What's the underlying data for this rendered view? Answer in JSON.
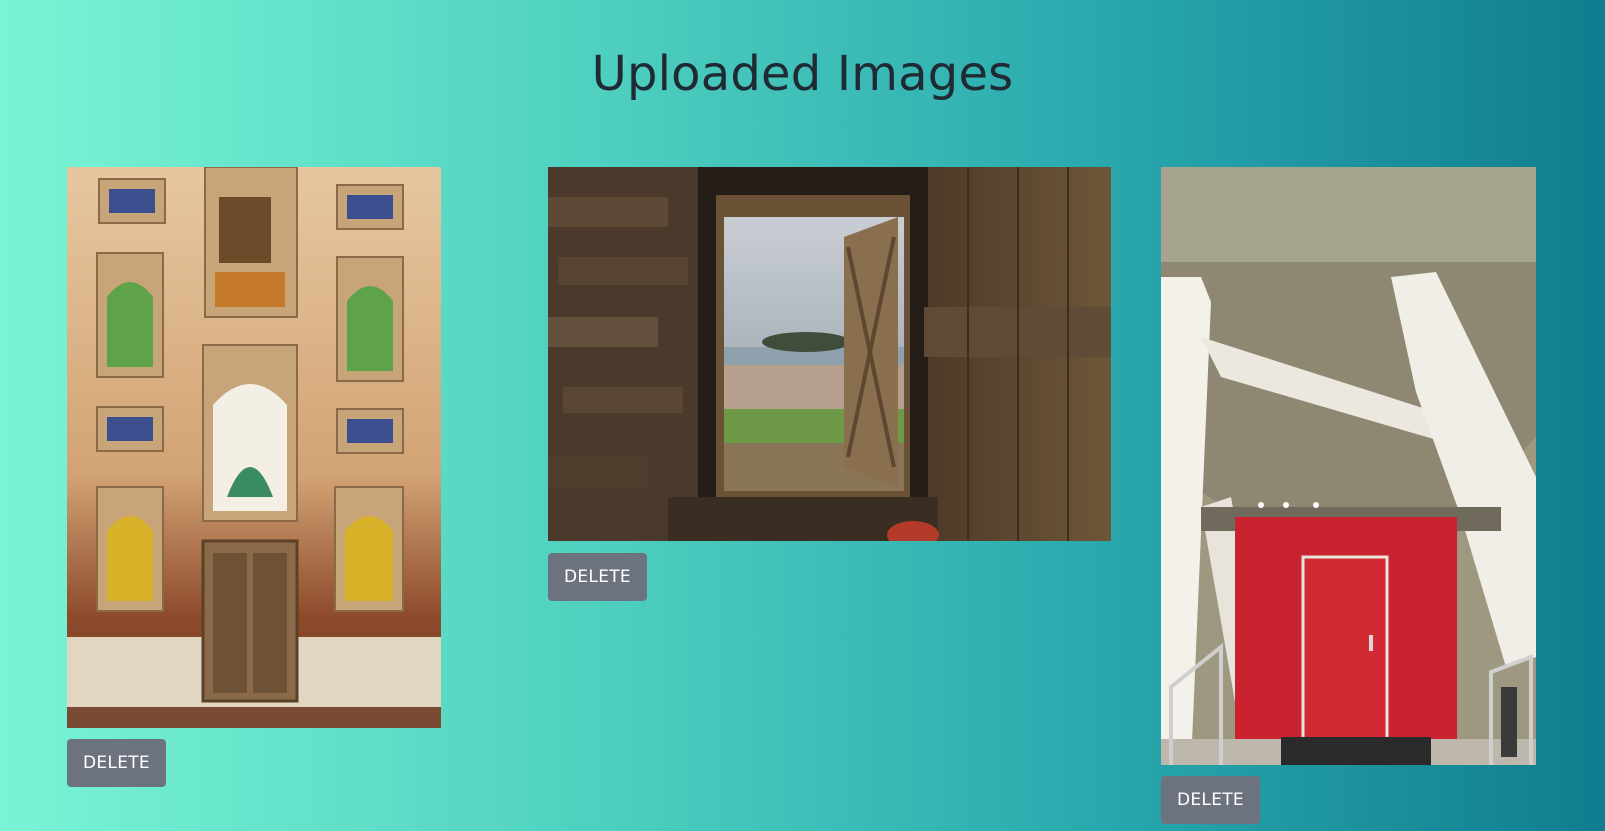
{
  "page": {
    "title": "Uploaded Images",
    "background_gradient": [
      "#79f5d5",
      "#0f7d8f"
    ]
  },
  "images": [
    {
      "subject": "tiled-facade-image",
      "delete_label": "DELETE"
    },
    {
      "subject": "barn-door-image",
      "delete_label": "DELETE"
    },
    {
      "subject": "red-door-image",
      "delete_label": "DELETE"
    }
  ],
  "colors": {
    "title": "#1f2a33",
    "button_bg": "#6c737f",
    "button_text": "#ffffff"
  }
}
